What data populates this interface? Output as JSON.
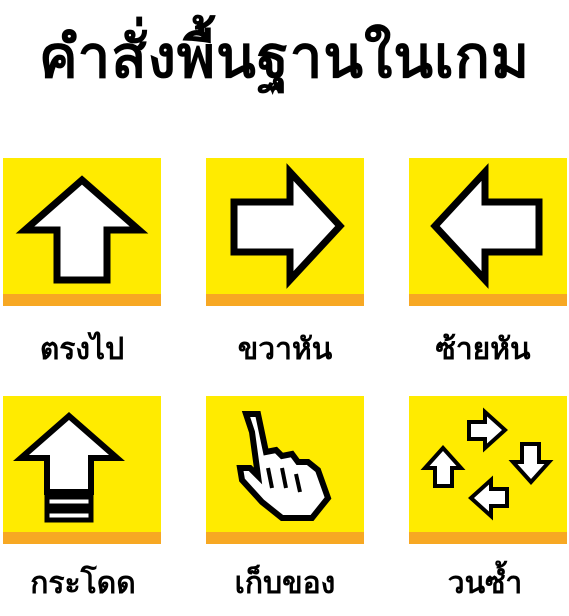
{
  "title": "คำสั่งพื้นฐานในเกม",
  "colors": {
    "card_face": "#ffeb00",
    "card_base": "#f7a823",
    "icon_fill": "#ffffff",
    "icon_stroke": "#000000"
  },
  "commands": [
    {
      "label": "ตรงไป",
      "icon": "arrow-up-icon"
    },
    {
      "label": "ขวาหัน",
      "icon": "arrow-right-icon"
    },
    {
      "label": "ซ้ายหัน",
      "icon": "arrow-left-icon"
    },
    {
      "label": "กระโดด",
      "icon": "jump-arrow-icon"
    },
    {
      "label": "เก็บของ",
      "icon": "hand-pointer-icon"
    },
    {
      "label": "วนซ้ำ",
      "icon": "loop-arrows-icon"
    }
  ]
}
